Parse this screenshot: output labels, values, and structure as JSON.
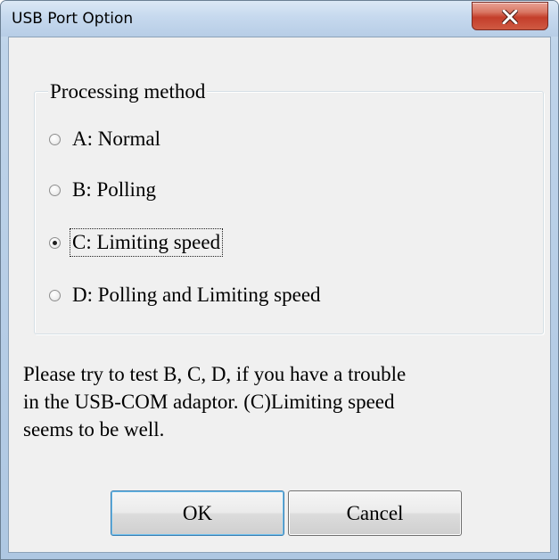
{
  "window": {
    "title": "USB Port Option",
    "close_icon": "close-icon"
  },
  "group": {
    "legend": "Processing method",
    "options": [
      {
        "label": "A: Normal",
        "selected": false
      },
      {
        "label": "B: Polling",
        "selected": false
      },
      {
        "label": "C: Limiting speed",
        "selected": true
      },
      {
        "label": "D: Polling and Limiting speed",
        "selected": false
      }
    ]
  },
  "note": {
    "line1": "Please try to test B, C, D, if you have a trouble",
    "line2": "in the USB-COM adaptor. (C)Limiting speed",
    "line3": "seems to be well."
  },
  "buttons": {
    "ok_label": "OK",
    "cancel_label": "Cancel"
  },
  "colors": {
    "close_button": "#c9452f",
    "dialog_bg": "#f0f0f0",
    "title_bar": "#c6d9ee"
  }
}
